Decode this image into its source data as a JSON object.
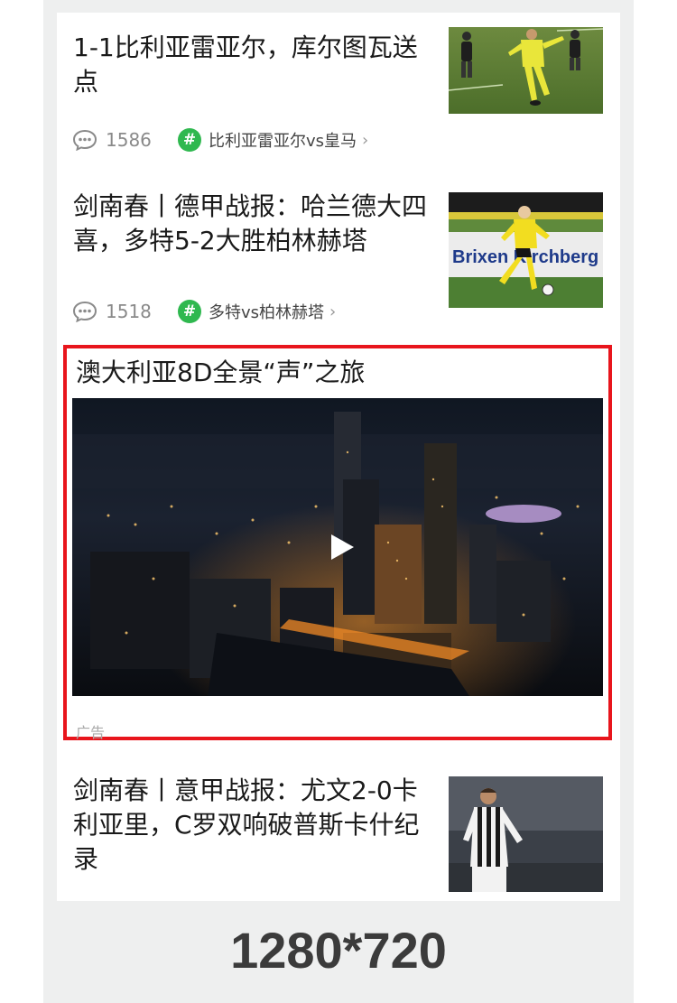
{
  "articles": [
    {
      "title": "1-1比利亚雷亚尔，库尔图瓦送点",
      "comments": "1586",
      "topic": "比利亚雷亚尔vs皇马",
      "thumb_icon": "soccer-player-yellow-kit"
    },
    {
      "title": "剑南春丨德甲战报：哈兰德大四喜，多特5-2大胜柏林赫塔",
      "comments": "1518",
      "topic": "多特vs柏林赫塔",
      "thumb_icon": "soccer-player-dortmund",
      "thumb_banner": "Brixen Kirchberg - W"
    },
    {
      "title": "剑南春丨意甲战报：尤文2-0卡利亚里，C罗双响破普斯卡什纪录",
      "thumb_icon": "soccer-player-juventus"
    }
  ],
  "ad": {
    "title": "澳大利亚8D全景“声”之旅",
    "label": "广告",
    "video_icon": "city-night-skyline",
    "play_icon": "play-icon"
  },
  "caption": "1280*720",
  "colors": {
    "highlight_border": "#e8151c",
    "topic_green": "#2fb84f",
    "frame_gray": "#eeefef"
  }
}
